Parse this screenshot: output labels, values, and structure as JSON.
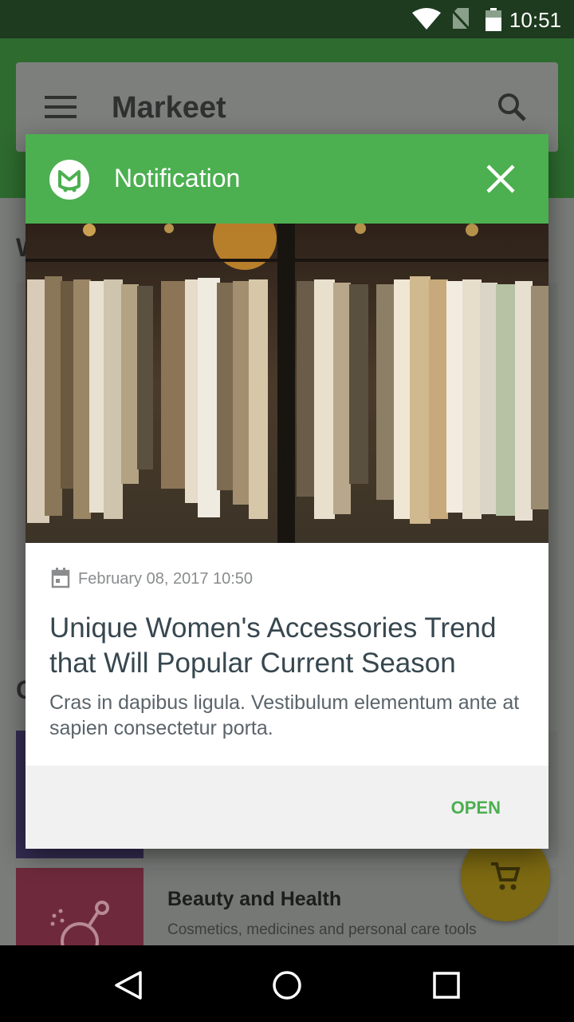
{
  "status_bar": {
    "time": "10:51"
  },
  "app_bar": {
    "title": "Markeet"
  },
  "background": {
    "edge_letters": [
      "W",
      "C"
    ],
    "category_card": {
      "title": "Beauty and Health",
      "subtitle": "Cosmetics, medicines and personal care tools"
    }
  },
  "dialog": {
    "title": "Notification",
    "date": "February 08, 2017 10:50",
    "heading": "Unique Women's Accessories Trend that Will Popular Current Season",
    "body": "Cras in dapibus ligula. Vestibulum elementum ante at sapien consectetur porta.",
    "open_label": "OPEN"
  },
  "colors": {
    "accent_green": "#4caf50",
    "status_bar": "#1e3a1f"
  },
  "icons": [
    "wifi-icon",
    "no-sim-icon",
    "battery-icon",
    "menu-icon",
    "search-icon",
    "app-logo-icon",
    "close-icon",
    "calendar-icon",
    "cart-icon",
    "back-icon",
    "home-icon",
    "recents-icon"
  ]
}
